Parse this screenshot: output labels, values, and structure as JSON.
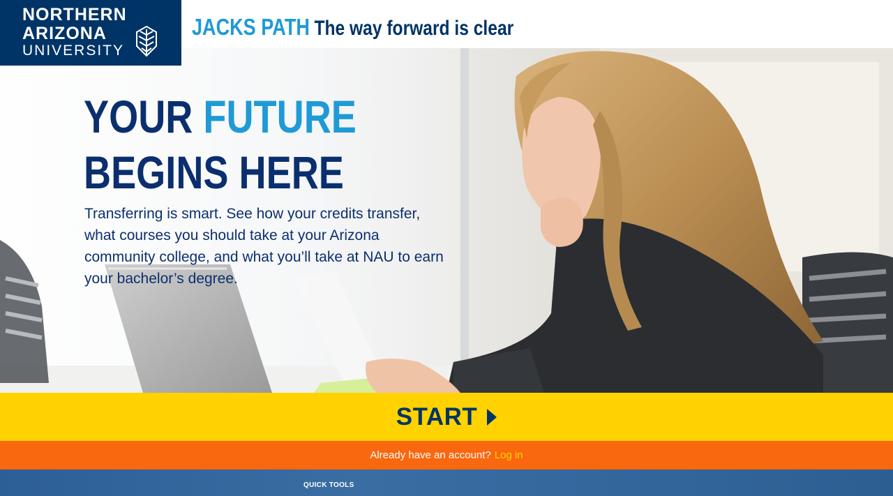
{
  "logo": {
    "line1": "NORTHERN",
    "line2": "ARIZONA",
    "line3": "UNIVERSITY",
    "icon": "nau-pine-emblem"
  },
  "header": {
    "brand": "JACKS PATH",
    "tagline": "The way forward is clear"
  },
  "hero": {
    "headline_line1_a": "YOUR",
    "headline_line1_b": "FUTURE",
    "headline_line2": "BEGINS HERE",
    "intro": "Transferring is smart. See how your credits transfer, what courses you should take at your Arizona community college, and what you’ll take at NAU to earn your bachelor’s degree."
  },
  "cta": {
    "start_label": "START",
    "start_icon": "caret-right-icon"
  },
  "login": {
    "prompt": "Already have an account?",
    "link": "Log in"
  },
  "footer": {
    "quick_tools": "QUICK TOOLS"
  },
  "colors": {
    "navy": "#003466",
    "sky": "#1f9ad7",
    "gold": "#ffd200",
    "orange": "#f9670e"
  }
}
